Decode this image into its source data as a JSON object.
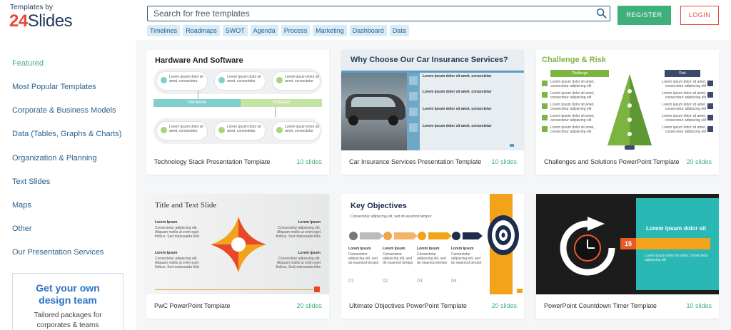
{
  "logo": {
    "top": "Templates by",
    "num": "24",
    "word": "Slides"
  },
  "search": {
    "placeholder": "Search for free templates"
  },
  "chips": [
    "Timelines",
    "Roadmaps",
    "SWOT",
    "Agenda",
    "Process",
    "Marketing",
    "Dashboard",
    "Data"
  ],
  "auth": {
    "register": "REGISTER",
    "login": "LOGIN"
  },
  "sidebar": {
    "items": [
      {
        "label": "Featured",
        "active": true
      },
      {
        "label": "Most Popular Templates"
      },
      {
        "label": "Corporate & Business Models"
      },
      {
        "label": "Data (Tables, Graphs & Charts)"
      },
      {
        "label": "Organization & Planning"
      },
      {
        "label": "Text Slides"
      },
      {
        "label": "Maps"
      },
      {
        "label": "Other"
      },
      {
        "label": "Our Presentation Services"
      }
    ],
    "promo": {
      "title": "Get your own design team",
      "text": "Tailored packages for corporates & teams"
    }
  },
  "cards": [
    {
      "title": "Technology Stack Presentation Template",
      "count": "10 slides",
      "thumb": {
        "heading": "Hardware And Software",
        "left_label": "Hardware",
        "right_label": "Software",
        "text": "Lorem ipsum dolor sit amet, consectetur"
      }
    },
    {
      "title": "Car Insurance Services Presentation Template",
      "count": "10 slides",
      "thumb": {
        "heading": "Why Choose Our Car Insurance Services?",
        "text": "Lorem ipsum dolor sit amet, consectetur"
      }
    },
    {
      "title": "Challenges and Solutions PowerPoint Template",
      "count": "20 slides",
      "thumb": {
        "heading": "Challenge & Risk",
        "left_label": "Challenge",
        "right_label": "Risk",
        "text": "Lorem ipsum dolor sit amet, consectetur adipiscing elit"
      }
    },
    {
      "title": "PwC PowerPoint Template",
      "count": "20 slides",
      "thumb": {
        "heading": "Title and Text Slide",
        "item": "Lorem Ipsum",
        "text": "Consectetur adipiscing elit. Aliquam mollis ut enim eget finibus. Sed malesuada felis"
      }
    },
    {
      "title": "Ultimate Objectives PowerPoint Template",
      "count": "20 slides",
      "thumb": {
        "heading": "Key Objectives",
        "item": "Lorem Ipsum",
        "steps": [
          "01",
          "02",
          "03",
          "04"
        ],
        "text": "Consectetur adipiscing elit, sed do eiusmod tempor"
      }
    },
    {
      "title": "PowerPoint Countdown Timer Template",
      "count": "10 slides",
      "thumb": {
        "heading": "Lorem ipsum dolor sit",
        "number": "15",
        "text": "Lorem ipsum dolor sit amet, consectetur adipiscing elit"
      }
    }
  ],
  "colors": {
    "accent_green": "#3fb07a",
    "login_red": "#e8473b",
    "link_blue": "#2a5f8a",
    "chip_bg": "#d8ecf7"
  }
}
